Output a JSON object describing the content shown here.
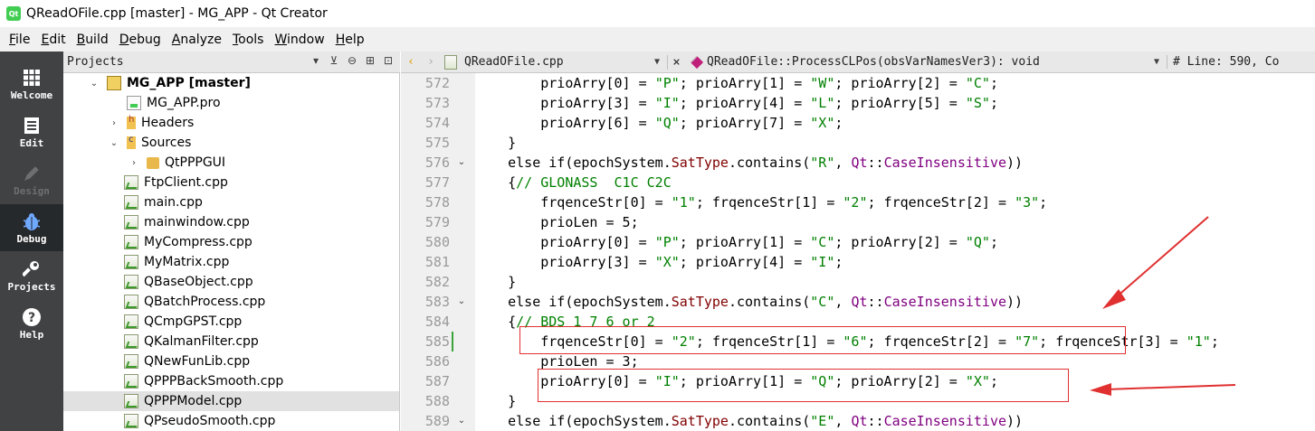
{
  "window": {
    "title": "QReadOFile.cpp [master] - MG_APP - Qt Creator",
    "icon_label": "Qt"
  },
  "menubar": [
    {
      "label": "File",
      "u": "F",
      "rest": "ile"
    },
    {
      "label": "Edit",
      "u": "E",
      "rest": "dit"
    },
    {
      "label": "Build",
      "u": "B",
      "rest": "uild"
    },
    {
      "label": "Debug",
      "u": "D",
      "rest": "ebug"
    },
    {
      "label": "Analyze",
      "u": "A",
      "rest": "nalyze"
    },
    {
      "label": "Tools",
      "u": "T",
      "rest": "ools"
    },
    {
      "label": "Window",
      "u": "W",
      "rest": "indow"
    },
    {
      "label": "Help",
      "u": "H",
      "rest": "elp"
    }
  ],
  "modes": [
    {
      "label": "Welcome",
      "icon": "grid-icon",
      "state": "normal"
    },
    {
      "label": "Edit",
      "icon": "document-icon",
      "state": "normal"
    },
    {
      "label": "Design",
      "icon": "pencil-icon",
      "state": "disabled"
    },
    {
      "label": "Debug",
      "icon": "bug-icon",
      "state": "active"
    },
    {
      "label": "Projects",
      "icon": "wrench-icon",
      "state": "normal"
    },
    {
      "label": "Help",
      "icon": "question-icon",
      "state": "normal"
    }
  ],
  "projects": {
    "title": "Projects",
    "tree": [
      {
        "label": "MG_APP [master]",
        "depth": 0,
        "arrow": "down",
        "icon": "proj",
        "bold": true
      },
      {
        "label": "MG_APP.pro",
        "depth": 1,
        "arrow": "",
        "icon": "pro"
      },
      {
        "label": "Headers",
        "depth": 1,
        "arrow": "right",
        "icon": "hdr"
      },
      {
        "label": "Sources",
        "depth": 1,
        "arrow": "down",
        "icon": "src"
      },
      {
        "label": "QtPPPGUI",
        "depth": 2,
        "arrow": "right",
        "icon": "folder"
      },
      {
        "label": "FtpClient.cpp",
        "depth": 2,
        "arrow": "",
        "icon": "cpp"
      },
      {
        "label": "main.cpp",
        "depth": 2,
        "arrow": "",
        "icon": "cpp"
      },
      {
        "label": "mainwindow.cpp",
        "depth": 2,
        "arrow": "",
        "icon": "cpp"
      },
      {
        "label": "MyCompress.cpp",
        "depth": 2,
        "arrow": "",
        "icon": "cpp"
      },
      {
        "label": "MyMatrix.cpp",
        "depth": 2,
        "arrow": "",
        "icon": "cpp"
      },
      {
        "label": "QBaseObject.cpp",
        "depth": 2,
        "arrow": "",
        "icon": "cpp"
      },
      {
        "label": "QBatchProcess.cpp",
        "depth": 2,
        "arrow": "",
        "icon": "cpp"
      },
      {
        "label": "QCmpGPST.cpp",
        "depth": 2,
        "arrow": "",
        "icon": "cpp"
      },
      {
        "label": "QKalmanFilter.cpp",
        "depth": 2,
        "arrow": "",
        "icon": "cpp"
      },
      {
        "label": "QNewFunLib.cpp",
        "depth": 2,
        "arrow": "",
        "icon": "cpp"
      },
      {
        "label": "QPPPBackSmooth.cpp",
        "depth": 2,
        "arrow": "",
        "icon": "cpp"
      },
      {
        "label": "QPPPModel.cpp",
        "depth": 2,
        "arrow": "",
        "icon": "cpp",
        "selected": true
      },
      {
        "label": "QPseudoSmooth.cpp",
        "depth": 2,
        "arrow": "",
        "icon": "cpp"
      }
    ]
  },
  "editor": {
    "file": "QReadOFile.cpp",
    "function": "QReadOFile::ProcessCLPos(obsVarNamesVer3): void",
    "position": "# Line: 590, Co",
    "lines": [
      {
        "n": "572",
        "fold": false,
        "marked": false,
        "text": "        prioArry[0] = \"P\"; prioArry[1] = \"W\"; prioArry[2] = \"C\";"
      },
      {
        "n": "573",
        "fold": false,
        "marked": false,
        "text": "        prioArry[3] = \"I\"; prioArry[4] = \"L\"; prioArry[5] = \"S\";"
      },
      {
        "n": "574",
        "fold": false,
        "marked": false,
        "text": "        prioArry[6] = \"Q\"; prioArry[7] = \"X\";"
      },
      {
        "n": "575",
        "fold": false,
        "marked": false,
        "text": "    }"
      },
      {
        "n": "576",
        "fold": true,
        "marked": false,
        "text": "    else if(epochSystem.SatType.contains(\"R\", Qt::CaseInsensitive))"
      },
      {
        "n": "577",
        "fold": false,
        "marked": false,
        "text": "    {// GLONASS  C1C C2C"
      },
      {
        "n": "578",
        "fold": false,
        "marked": false,
        "text": "        frqenceStr[0] = \"1\"; frqenceStr[1] = \"2\"; frqenceStr[2] = \"3\";"
      },
      {
        "n": "579",
        "fold": false,
        "marked": false,
        "text": "        prioLen = 5;"
      },
      {
        "n": "580",
        "fold": false,
        "marked": false,
        "text": "        prioArry[0] = \"P\"; prioArry[1] = \"C\"; prioArry[2] = \"Q\";"
      },
      {
        "n": "581",
        "fold": false,
        "marked": false,
        "text": "        prioArry[3] = \"X\"; prioArry[4] = \"I\";"
      },
      {
        "n": "582",
        "fold": false,
        "marked": false,
        "text": "    }"
      },
      {
        "n": "583",
        "fold": true,
        "marked": false,
        "text": "    else if(epochSystem.SatType.contains(\"C\", Qt::CaseInsensitive))"
      },
      {
        "n": "584",
        "fold": false,
        "marked": false,
        "text": "    {// BDS 1 7 6 or 2"
      },
      {
        "n": "585",
        "fold": false,
        "marked": true,
        "text": "        frqenceStr[0] = \"2\"; frqenceStr[1] = \"6\"; frqenceStr[2] = \"7\"; frqenceStr[3] = \"1\";"
      },
      {
        "n": "586",
        "fold": false,
        "marked": false,
        "text": "        prioLen = 3;"
      },
      {
        "n": "587",
        "fold": false,
        "marked": false,
        "text": "        prioArry[0] = \"I\"; prioArry[1] = \"Q\"; prioArry[2] = \"X\";"
      },
      {
        "n": "588",
        "fold": false,
        "marked": false,
        "text": "    }"
      },
      {
        "n": "589",
        "fold": true,
        "marked": false,
        "text": "    else if(epochSystem.SatType.contains(\"E\", Qt::CaseInsensitive))"
      }
    ]
  },
  "colors": {
    "annotation": "#e03030",
    "string": "#008000",
    "qt_class": "#800080",
    "member": "#800000"
  }
}
